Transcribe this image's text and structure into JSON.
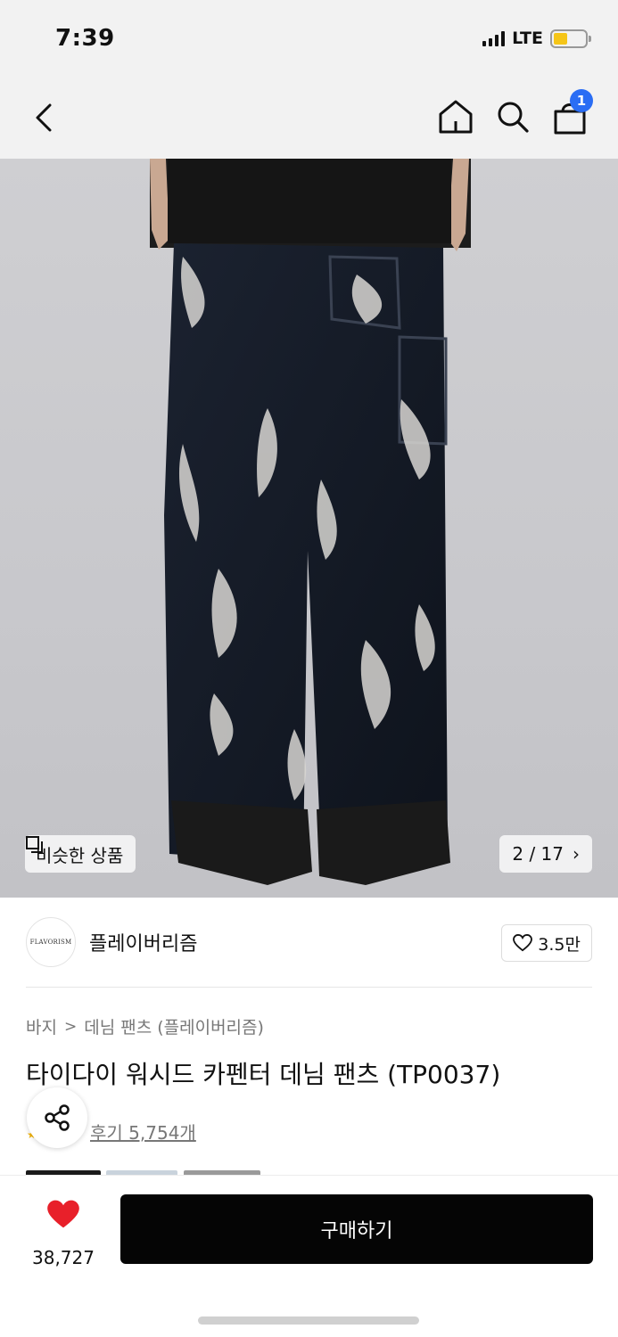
{
  "status_bar": {
    "time": "7:39",
    "network": "LTE",
    "battery_level": 0.45
  },
  "nav": {
    "cart_count": "1",
    "icons": [
      "back-icon",
      "home-icon",
      "search-icon",
      "cart-icon"
    ]
  },
  "gallery": {
    "similar_label": "비슷한 상품",
    "counter": "2 / 17",
    "counter_chevron": "›"
  },
  "brand": {
    "logo_text": "FLAVORISM",
    "name": "플레이버리즘",
    "like_count": "3.5만"
  },
  "product": {
    "breadcrumb": [
      "바지",
      "데님 팬츠 (플레이버리즘)"
    ],
    "breadcrumb_sep": ">",
    "title": "타이다이 워시드 카펜터 데님 팬츠 (TP0037)",
    "review_link": "후기 5,754개"
  },
  "bottom_bar": {
    "heart_count": "38,727",
    "buy_label": "구매하기"
  },
  "colors": {
    "badge_blue": "#2a6df4",
    "heart_red": "#e8202a",
    "buy_black": "#050505"
  }
}
